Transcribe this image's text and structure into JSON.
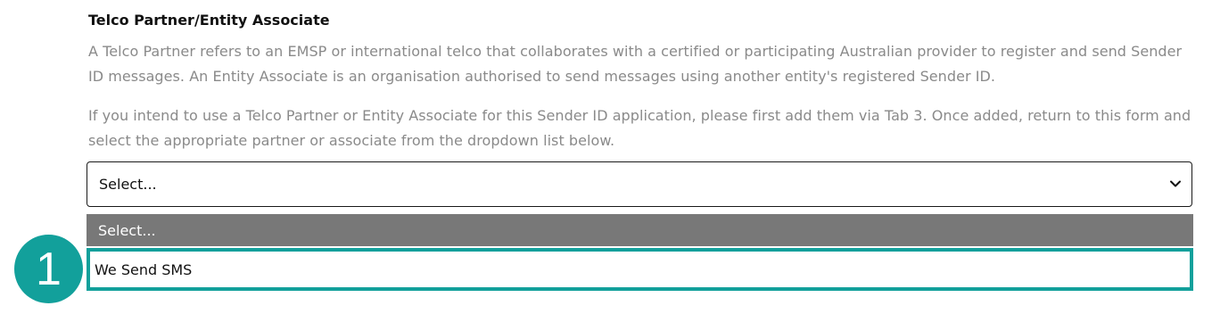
{
  "section": {
    "title": "Telco Partner/Entity Associate",
    "description_1": "A Telco Partner refers to an EMSP or international telco that collaborates with a certified or participating Australian provider to register and send Sender ID messages. An Entity Associate is an organisation authorised to send messages using another entity's registered Sender ID.",
    "description_2": "If you intend to use a Telco Partner or Entity Associate for this Sender ID application, please first add them via Tab 3. Once added, return to this form and select the appropriate partner or associate from the dropdown list below."
  },
  "select": {
    "value": "Select...",
    "icon": "chevron-down-icon",
    "options": [
      {
        "label": "Select...",
        "state": "selected"
      },
      {
        "label": "We Send SMS",
        "state": "highlighted"
      }
    ]
  },
  "annotation": {
    "step_number": "1"
  },
  "colors": {
    "accent": "#12a09b",
    "selected_option_bg": "#787878",
    "muted_text": "#8a8a8a"
  }
}
